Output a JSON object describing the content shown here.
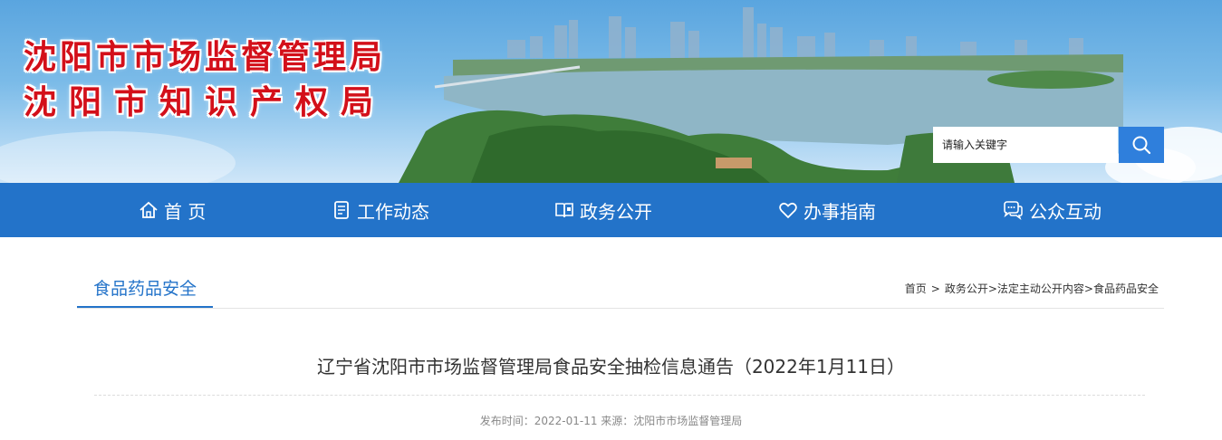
{
  "header": {
    "title_line1": "沈阳市市场监督管理局",
    "title_line2": "沈阳市知识产权局",
    "search": {
      "placeholder": "请输入关键字",
      "button_icon": "search-icon"
    }
  },
  "nav": {
    "items": [
      {
        "label": "首 页",
        "icon": "home-icon"
      },
      {
        "label": "工作动态",
        "icon": "document-icon"
      },
      {
        "label": "政务公开",
        "icon": "book-icon"
      },
      {
        "label": "办事指南",
        "icon": "heart-icon"
      },
      {
        "label": "公众互动",
        "icon": "chat-icon"
      }
    ]
  },
  "section": {
    "title": "食品药品安全",
    "breadcrumb": [
      "首页",
      "政务公开",
      "法定主动公开内容",
      "食品药品安全"
    ]
  },
  "article": {
    "title": "辽宁省沈阳市市场监督管理局食品安全抽检信息通告（2022年1月11日）",
    "meta": "发布时间：2022-01-11 来源：沈阳市市场监督管理局"
  },
  "colors": {
    "nav_bg": "#2373c9",
    "title_red": "#d3101a",
    "accent_blue": "#2373c9"
  }
}
